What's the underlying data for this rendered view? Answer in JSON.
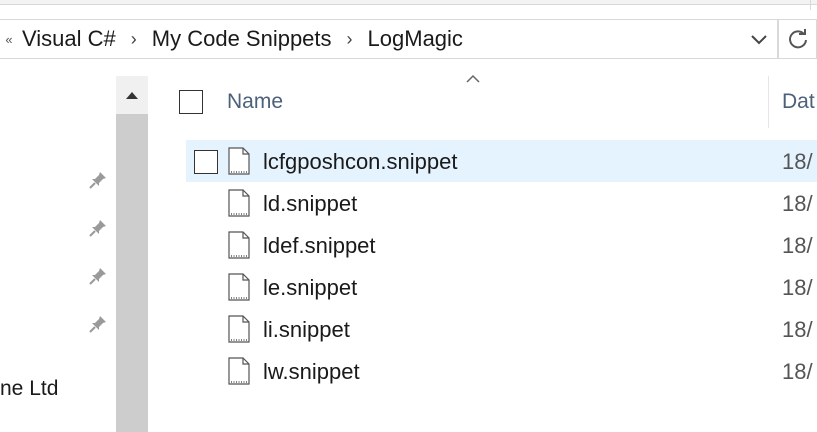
{
  "address_bar": {
    "overflow_glyph": "«",
    "breadcrumbs": [
      "Visual C#",
      "My Code Snippets",
      "LogMagic"
    ],
    "separator": "›"
  },
  "icons": {
    "dropdown": "chevron-down-icon",
    "refresh": "refresh-icon",
    "pin": "pin-icon",
    "scroll_up": "chevron-up-icon",
    "file": "file-icon",
    "sort": "sort-ascending-icon"
  },
  "nav_pane": {
    "pinned_count": 4,
    "partial_item_text": "ne Ltd"
  },
  "file_list": {
    "columns": {
      "name": "Name",
      "date": "Dat"
    },
    "files": [
      {
        "name": "lcfgposhcon.snippet",
        "date": "18/",
        "hovered": true
      },
      {
        "name": "ld.snippet",
        "date": "18/",
        "hovered": false
      },
      {
        "name": "ldef.snippet",
        "date": "18/",
        "hovered": false
      },
      {
        "name": "le.snippet",
        "date": "18/",
        "hovered": false
      },
      {
        "name": "li.snippet",
        "date": "18/",
        "hovered": false
      },
      {
        "name": "lw.snippet",
        "date": "18/",
        "hovered": false
      }
    ]
  },
  "colors": {
    "hover_row": "#e5f3ff",
    "header_text": "#4c607a",
    "scroll_thumb": "#cdcdcd",
    "scroll_track": "#f0f0f0"
  }
}
